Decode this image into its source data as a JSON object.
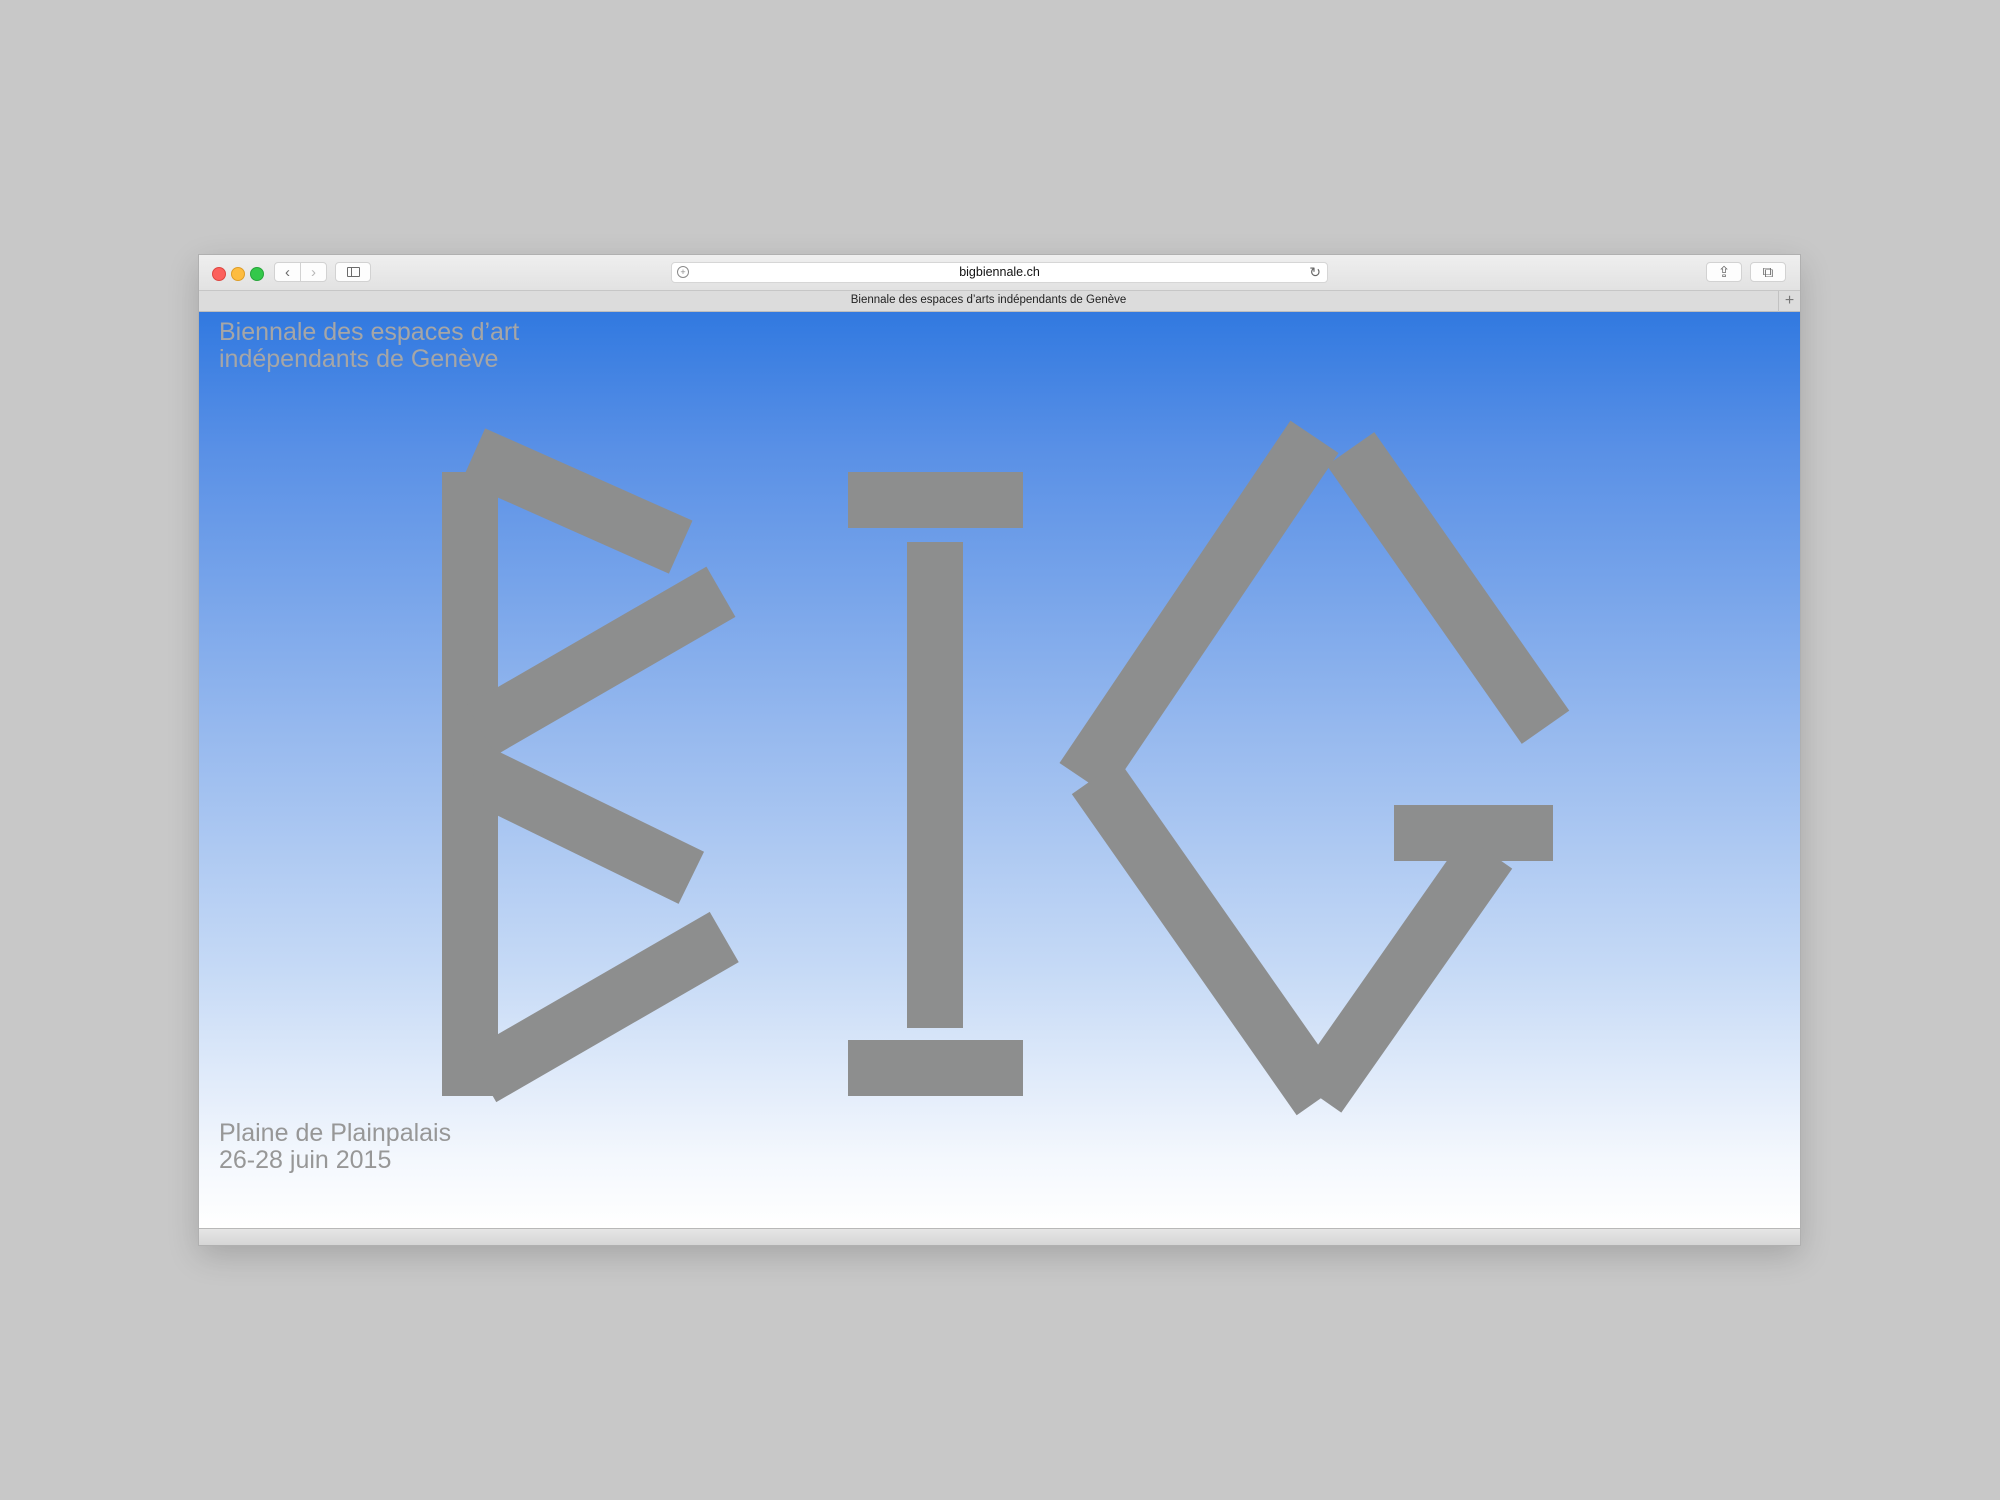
{
  "browser": {
    "address": "bigbiennale.ch",
    "tab_title": "Biennale des espaces d’arts indépendants de Genève",
    "new_tab": "+",
    "back": "‹",
    "forward": "›",
    "reload": "↻",
    "reader": "+",
    "share": "⇪",
    "tabs": "⧉"
  },
  "page": {
    "title_lines": [
      "Biennale des espaces d’art",
      "indépendants de Genève"
    ],
    "venue": "Plaine de Plainpalais",
    "dates": "26-28 juin 2015",
    "logo_color": "#8d8e8e",
    "gradient": [
      "#3179e0",
      "#ffffff"
    ]
  }
}
